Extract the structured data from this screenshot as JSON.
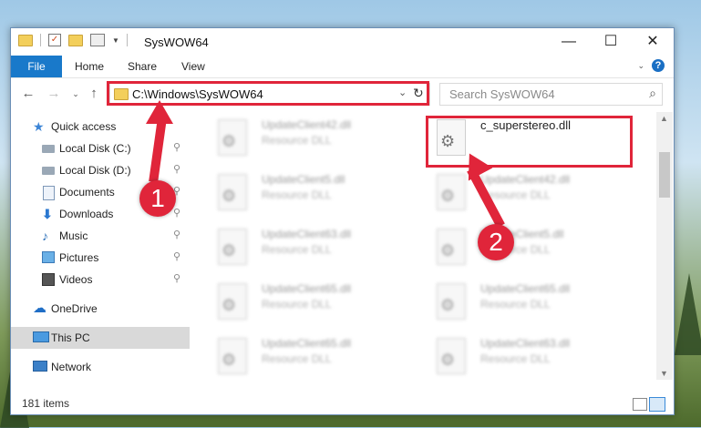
{
  "window": {
    "title": "SysWOW64"
  },
  "ribbon": {
    "file": "File",
    "home": "Home",
    "share": "Share",
    "view": "View"
  },
  "address": {
    "path": "C:\\Windows\\SysWOW64"
  },
  "search": {
    "placeholder": "Search SysWOW64"
  },
  "sidebar": {
    "quick_access": "Quick access",
    "items": [
      "Local Disk (C:)",
      "Local Disk (D:)",
      "Documents",
      "Downloads",
      "Music",
      "Pictures",
      "Videos"
    ],
    "onedrive": "OneDrive",
    "this_pc": "This PC",
    "network": "Network"
  },
  "files": {
    "left": [
      {
        "name": "UpdateClient42.dll",
        "type": "Resource DLL"
      },
      {
        "name": "UpdateClient5.dll",
        "type": "Resource DLL"
      },
      {
        "name": "UpdateClient63.dll",
        "type": "Resource DLL"
      },
      {
        "name": "UpdateClient65.dll",
        "type": "Resource DLL"
      },
      {
        "name": "UpdateClient65.dll",
        "type": "Resource DLL"
      }
    ],
    "right": [
      {
        "name": "c_superstereo.dll",
        "type": ""
      },
      {
        "name": "UpdateClient42.dll",
        "type": "Resource DLL"
      },
      {
        "name": "UpdateClient5.dll",
        "type": "Resource DLL"
      },
      {
        "name": "UpdateClient65.dll",
        "type": "Resource DLL"
      },
      {
        "name": "UpdateClient63.dll",
        "type": "Resource DLL"
      }
    ]
  },
  "status": {
    "items_count": "181 items"
  },
  "annotations": {
    "step1": "1",
    "step2": "2"
  },
  "colors": {
    "accent": "#1979ca",
    "annotation_red": "#e0253a"
  }
}
